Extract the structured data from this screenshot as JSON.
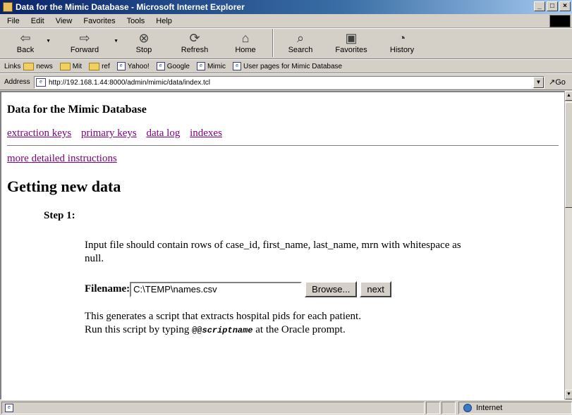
{
  "window": {
    "title": "Data for the Mimic Database - Microsoft Internet Explorer"
  },
  "menu": [
    "File",
    "Edit",
    "View",
    "Favorites",
    "Tools",
    "Help"
  ],
  "toolbar": {
    "back": "Back",
    "forward": "Forward",
    "stop": "Stop",
    "refresh": "Refresh",
    "home": "Home",
    "search": "Search",
    "favorites": "Favorites",
    "history": "History"
  },
  "links": {
    "label": "Links",
    "items": [
      "news",
      "Mit",
      "ref",
      "Yahoo!",
      "Google",
      "Mimic",
      "User pages for Mimic Database"
    ]
  },
  "address": {
    "label": "Address",
    "url": "http://192.168.1.44:8000/admin/mimic/data/index.tcl",
    "go": "Go"
  },
  "page": {
    "title": "Data for the Mimic Database",
    "nav": [
      "extraction keys",
      "primary keys",
      "data log",
      "indexes"
    ],
    "more_instructions": "more detailed instructions",
    "heading": "Getting new data",
    "step": "Step 1:",
    "instruction": "Input file should contain rows of case_id, first_name, last_name, mrn with whitespace as null.",
    "filename_label": "Filename:",
    "filename_value": "C:\\TEMP\\names.csv",
    "browse_button": "Browse...",
    "next_button": "next",
    "result_line1": "This generates a script that extracts hospital pids for each patient.",
    "result_line2_prefix": "Run this script by typing ",
    "result_command_at": "@@",
    "result_command_name": "scriptname",
    "result_line2_suffix": " at the Oracle prompt."
  },
  "status": {
    "zone": "Internet"
  }
}
